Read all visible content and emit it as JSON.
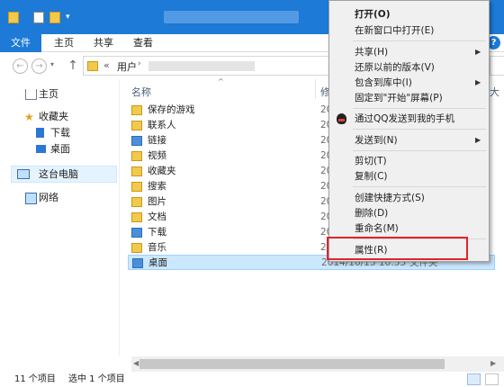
{
  "ribbon": {
    "tabs": [
      "文件",
      "主页",
      "共享",
      "查看"
    ]
  },
  "address": {
    "chevrons": "«",
    "segment": "用户"
  },
  "nav": {
    "items": [
      "主页",
      "收藏夹",
      "下载",
      "桌面",
      "这台电脑",
      "网络"
    ]
  },
  "columns": {
    "name": "名称",
    "date_fragment": "修",
    "size_fragment": "大"
  },
  "files": [
    {
      "name": "保存的游戏",
      "date": "20",
      "type": ""
    },
    {
      "name": "联系人",
      "date": "20",
      "type": ""
    },
    {
      "name": "链接",
      "date": "20",
      "type": ""
    },
    {
      "name": "视频",
      "date": "20",
      "type": ""
    },
    {
      "name": "收藏夹",
      "date": "20",
      "type": ""
    },
    {
      "name": "搜索",
      "date": "20",
      "type": ""
    },
    {
      "name": "图片",
      "date": "20",
      "type": ""
    },
    {
      "name": "文档",
      "date": "20",
      "type": ""
    },
    {
      "name": "下载",
      "date": "20",
      "type": ""
    },
    {
      "name": "音乐",
      "date": "20",
      "type": ""
    },
    {
      "name": "桌面",
      "date": "2014/10/15 10:55",
      "type": "文件夹"
    }
  ],
  "context_menu": {
    "items": [
      "打开(O)",
      "在新窗口中打开(E)",
      "共享(H)",
      "还原以前的版本(V)",
      "包含到库中(I)",
      "固定到\"开始\"屏幕(P)",
      "通过QQ发送到我的手机",
      "发送到(N)",
      "剪切(T)",
      "复制(C)",
      "创建快捷方式(S)",
      "删除(D)",
      "重命名(M)",
      "属性(R)"
    ]
  },
  "status": {
    "count": "11 个项目",
    "selected": "选中 1 个项目"
  },
  "colors": {
    "accent": "#1d7ad6",
    "selection": "#cce8ff",
    "highlight_box": "#e0252a"
  },
  "icons": [
    "folder-icon",
    "home-icon",
    "star-icon",
    "download-icon",
    "desktop-icon",
    "computer-icon",
    "network-icon",
    "qq-icon",
    "help-icon"
  ]
}
